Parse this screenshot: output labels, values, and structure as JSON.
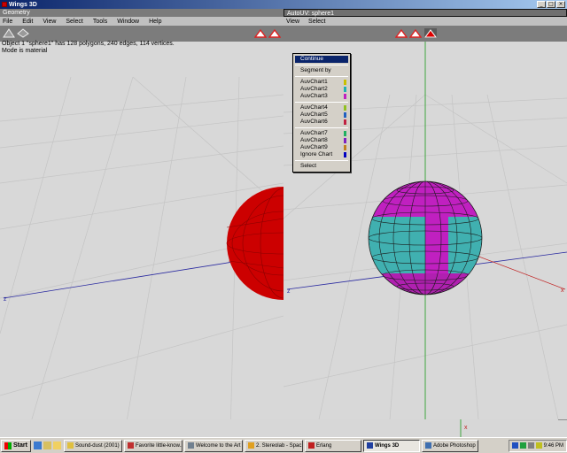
{
  "app": {
    "title": "Wings 3D"
  },
  "titlebar_buttons": {
    "minimize": "_",
    "maximize": "□",
    "close": "×"
  },
  "geometry": {
    "title": "Geometry",
    "menu": [
      "File",
      "Edit",
      "View",
      "Select",
      "Tools",
      "Window",
      "Help"
    ],
    "info_line1": "Object 1 \"sphere1\" has 128 polygons, 240 edges, 114 vertices.",
    "info_line2": "Mode is material",
    "axis_label": "z"
  },
  "autouv": {
    "title": "AutoUV: sphere1",
    "menu": [
      "View",
      "Select"
    ],
    "axis_labels": {
      "x": "x",
      "z": "z",
      "bottom_x": "x"
    }
  },
  "popup": {
    "items": [
      {
        "label": "Continue",
        "highlighted": true
      },
      {
        "label": "Segment by"
      },
      {
        "label": "AuvChart1",
        "color": "#c8c000"
      },
      {
        "label": "AuvChart2",
        "color": "#20b0b0"
      },
      {
        "label": "AuvChart3",
        "color": "#c020c0"
      },
      {
        "label": "AuvChart4",
        "color": "#90c020"
      },
      {
        "label": "AuvChart5",
        "color": "#2060c0"
      },
      {
        "label": "AuvChart6",
        "color": "#c02040"
      },
      {
        "label": "AuvChart7",
        "color": "#20b060"
      },
      {
        "label": "AuvChart8",
        "color": "#8020c0"
      },
      {
        "label": "AuvChart9",
        "color": "#c08020"
      },
      {
        "label": "Ignore Chart",
        "color": "#0000c0"
      },
      {
        "label": "Select"
      }
    ]
  },
  "colors": {
    "sphere_red": "#cc0000",
    "chart_cyan": "#40b0b0",
    "chart_magenta": "#c020c0"
  },
  "taskbar": {
    "start": "Start",
    "tasks": [
      "Sound-dust (2001)",
      "Favorite little-know...",
      "Welcome to the Art ...",
      "2. Stereolab - Spac...",
      "Erlang",
      "Wings 3D",
      "Adobe Photoshop"
    ],
    "active_task": "Wings 3D",
    "clock": "9:46 PM"
  }
}
